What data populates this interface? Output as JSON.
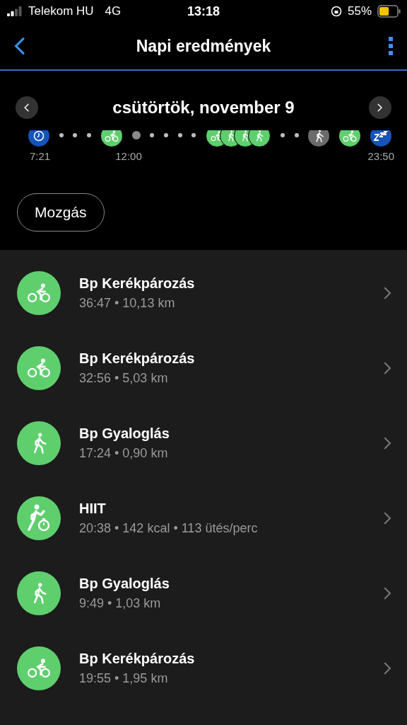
{
  "status_bar": {
    "carrier": "Telekom HU",
    "network": "4G",
    "time": "13:18",
    "battery": "55%"
  },
  "header": {
    "title": "Napi eredmények"
  },
  "date_nav": {
    "date": "csütörtök, november 9"
  },
  "timeline": {
    "markers": [
      {
        "kind": "clock"
      },
      {
        "kind": "dot"
      },
      {
        "kind": "dot"
      },
      {
        "kind": "dot"
      },
      {
        "kind": "bike"
      },
      {
        "kind": "greydot"
      },
      {
        "kind": "dot"
      },
      {
        "kind": "dot"
      },
      {
        "kind": "dot"
      },
      {
        "kind": "dot"
      },
      {
        "kind": "cluster"
      },
      {
        "kind": "dot"
      },
      {
        "kind": "dot"
      },
      {
        "kind": "greywalk"
      },
      {
        "kind": "bike"
      },
      {
        "kind": "sleep"
      }
    ],
    "labels": [
      "7:21",
      "12:00",
      "23:50"
    ]
  },
  "filter": {
    "label": "Mozgás"
  },
  "activities": [
    {
      "kind": "bike",
      "name": "Bp Kerékpározás",
      "details": "36:47 • 10,13 km"
    },
    {
      "kind": "bike",
      "name": "Bp Kerékpározás",
      "details": "32:56 • 5,03 km"
    },
    {
      "kind": "walk",
      "name": "Bp Gyaloglás",
      "details": "17:24 • 0,90 km"
    },
    {
      "kind": "hiit",
      "name": "HIIT",
      "details": "20:38 • 142 kcal • 113 ütés/perc"
    },
    {
      "kind": "walk",
      "name": "Bp Gyaloglás",
      "details": "9:49 • 1,03 km"
    },
    {
      "kind": "bike",
      "name": "Bp Kerékpározás",
      "details": "19:55 • 1,95 km"
    }
  ]
}
